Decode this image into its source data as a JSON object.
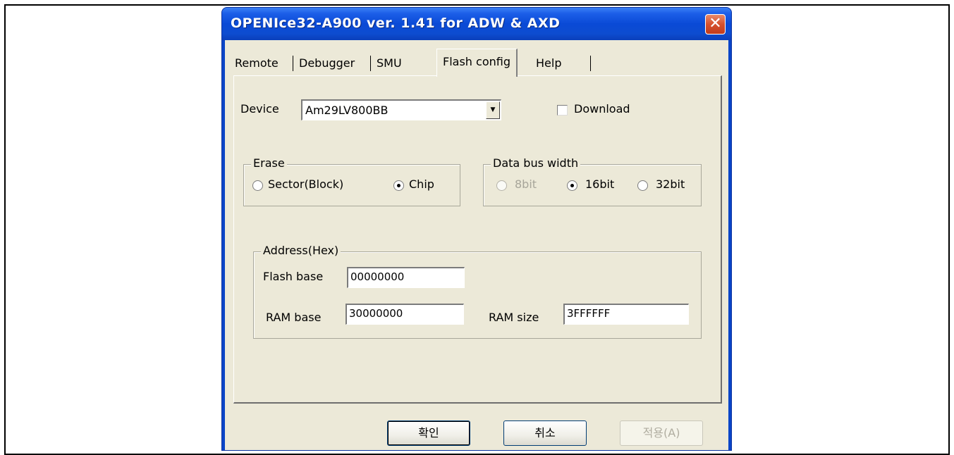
{
  "window": {
    "title": "OPENIce32-A900  ver. 1.41 for ADW & AXD",
    "close_glyph": "✕"
  },
  "tabs": [
    {
      "label": "Remote"
    },
    {
      "label": "Debugger"
    },
    {
      "label": "SMU"
    },
    {
      "label": "Flash config"
    },
    {
      "label": "Help"
    }
  ],
  "active_tab": "Flash config",
  "device": {
    "label": "Device",
    "value": "Am29LV800BB",
    "dropdown_glyph": "▼"
  },
  "download": {
    "label": "Download",
    "checked": false
  },
  "erase": {
    "title": "Erase",
    "options": [
      {
        "label": "Sector(Block)",
        "selected": false
      },
      {
        "label": "Chip",
        "selected": true
      }
    ]
  },
  "data_bus_width": {
    "title": "Data bus width",
    "options": [
      {
        "label": "8bit",
        "selected": false,
        "disabled": true
      },
      {
        "label": "16bit",
        "selected": true,
        "disabled": false
      },
      {
        "label": "32bit",
        "selected": false,
        "disabled": false
      }
    ]
  },
  "address": {
    "title": "Address(Hex)",
    "flash_base_label": "Flash base",
    "flash_base_value": "00000000",
    "ram_base_label": "RAM base",
    "ram_base_value": "30000000",
    "ram_size_label": "RAM size",
    "ram_size_value": "3FFFFFF"
  },
  "buttons": {
    "ok": "확인",
    "cancel": "취소",
    "apply": "적용(A)"
  },
  "colors": {
    "titlebar": "#0a4ad6",
    "client": "#ece9d8",
    "close": "#d6512d"
  }
}
